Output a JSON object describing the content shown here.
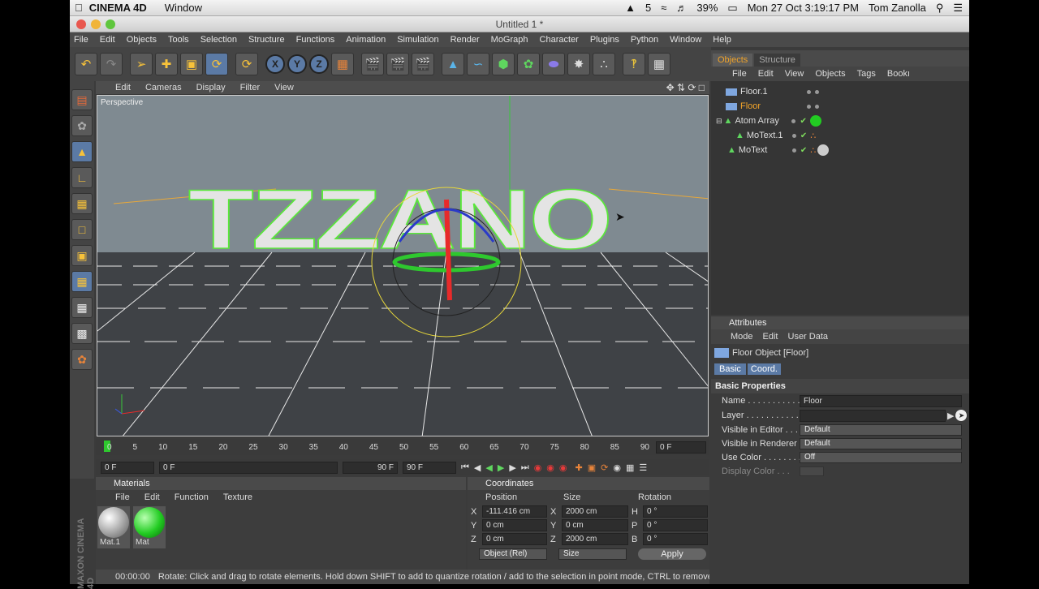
{
  "mac": {
    "app": "CINEMA 4D",
    "window_menu": "Window",
    "badge": "5",
    "battery": "39%",
    "datetime": "Mon 27 Oct  3:19:17 PM",
    "user": "Tom Zanolla"
  },
  "window": {
    "title": "Untitled 1 *"
  },
  "menu": [
    "File",
    "Edit",
    "Objects",
    "Tools",
    "Selection",
    "Structure",
    "Functions",
    "Animation",
    "Simulation",
    "Render",
    "MoGraph",
    "Character",
    "Plugins",
    "Python",
    "Window",
    "Help"
  ],
  "toolbar": {
    "axes": [
      "X",
      "Y",
      "Z"
    ]
  },
  "viewport": {
    "menu": [
      "Edit",
      "Cameras",
      "Display",
      "Filter",
      "View"
    ],
    "label": "Perspective",
    "text3d": "TZZANO"
  },
  "timeline": {
    "ticks": [
      "0",
      "5",
      "10",
      "15",
      "20",
      "25",
      "30",
      "35",
      "40",
      "45",
      "50",
      "55",
      "60",
      "65",
      "70",
      "75",
      "80",
      "85",
      "90"
    ],
    "current": "0 F",
    "start": "0 F",
    "range_start": "0 F",
    "range_end": "90 F",
    "end": "90 F"
  },
  "materials": {
    "title": "Materials",
    "menu": [
      "File",
      "Edit",
      "Function",
      "Texture"
    ],
    "items": [
      {
        "name": "Mat.1",
        "color": "#d0d0d0"
      },
      {
        "name": "Mat",
        "color": "#22cc22"
      }
    ]
  },
  "coordinates": {
    "title": "Coordinates",
    "headers": [
      "Position",
      "Size",
      "Rotation"
    ],
    "rows": [
      {
        "axis": "X",
        "pos": "-111.416 cm",
        "saxis": "X",
        "size": "2000 cm",
        "raxis": "H",
        "rot": "0 °"
      },
      {
        "axis": "Y",
        "pos": "0 cm",
        "saxis": "Y",
        "size": "0 cm",
        "raxis": "P",
        "rot": "0 °"
      },
      {
        "axis": "Z",
        "pos": "0 cm",
        "saxis": "Z",
        "size": "2000 cm",
        "raxis": "B",
        "rot": "0 °"
      }
    ],
    "mode": "Object (Rel)",
    "size_mode": "Size",
    "apply": "Apply"
  },
  "status": {
    "time": "00:00:00",
    "message": "Rotate: Click and drag to rotate elements. Hold down SHIFT to add to quantize rotation / add to the selection in point mode, CTRL to remove"
  },
  "objects": {
    "tabs": [
      "Objects",
      "Structure"
    ],
    "menu": [
      "File",
      "Edit",
      "View",
      "Objects",
      "Tags",
      "Bookı"
    ],
    "items": [
      {
        "name": "Floor.1",
        "indent": 0
      },
      {
        "name": "Floor",
        "indent": 0,
        "selected": true
      },
      {
        "name": "Atom Array",
        "indent": 0
      },
      {
        "name": "MoText.1",
        "indent": 1
      },
      {
        "name": "MoText",
        "indent": 0
      }
    ]
  },
  "attributes": {
    "title": "Attributes",
    "menu": [
      "Mode",
      "Edit",
      "User Data"
    ],
    "object": "Floor Object [Floor]",
    "tabs": [
      "Basic",
      "Coord."
    ],
    "section": "Basic Properties",
    "props": [
      {
        "label": "Name . . . . . . . . . . . .",
        "value": "Floor"
      },
      {
        "label": "Layer . . . . . . . . . . . .",
        "value": ""
      },
      {
        "label": "Visible in Editor . . .",
        "value": "Default"
      },
      {
        "label": "Visible in Renderer",
        "value": "Default"
      },
      {
        "label": "Use Color . . . . . . . .",
        "value": "Off"
      },
      {
        "label": "Display Color . . .",
        "value": ""
      }
    ]
  },
  "brand": "MAXON CINEMA 4D"
}
